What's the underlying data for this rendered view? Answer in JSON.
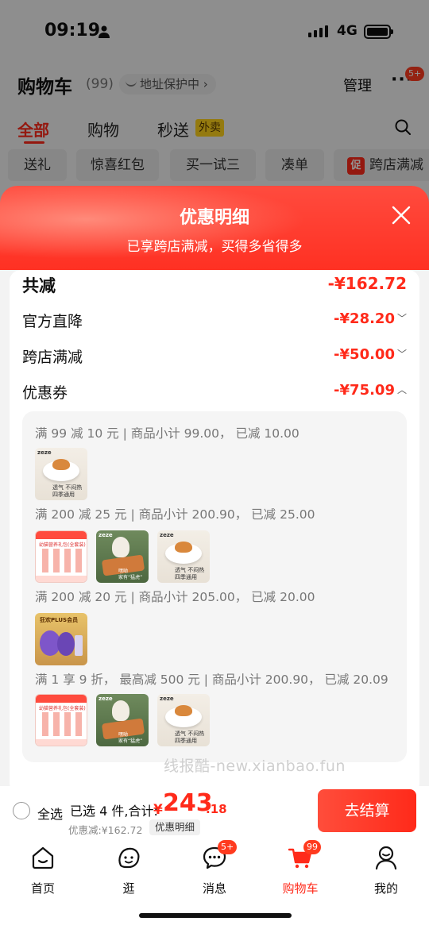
{
  "status": {
    "time": "09:19",
    "network": "4G"
  },
  "header": {
    "title": "购物车",
    "count": "(99)",
    "address_protect": "地址保护中 ›",
    "manage": "管理",
    "more": "···",
    "more_badge": "5+"
  },
  "tabs": [
    {
      "label": "全部"
    },
    {
      "label": "购物"
    },
    {
      "label": "秒送"
    }
  ],
  "takeaway_tag": "外卖",
  "chips": [
    {
      "label": "送礼"
    },
    {
      "label": "惊喜红包"
    },
    {
      "label": "买一试三"
    },
    {
      "label": "凑单"
    },
    {
      "label": "跨店满减"
    }
  ],
  "promo_icon_text": "促",
  "sheet": {
    "title": "优惠明细",
    "subtitle": "已享跨店满减，买得多省得多",
    "rows": [
      {
        "label": "共减",
        "amount": "-¥162.72"
      },
      {
        "label": "官方直降",
        "amount": "-¥28.20",
        "chevron": "﹀"
      },
      {
        "label": "跨店满减",
        "amount": "-¥50.00",
        "chevron": "﹀"
      },
      {
        "label": "优惠券",
        "amount": "-¥75.09",
        "chevron": "︿"
      }
    ],
    "coupons": [
      {
        "text": "满 99 减 10 元 | 商品小计 99.00， 已减 10.00"
      },
      {
        "text": "满 200 减 25 元 | 商品小计 200.90， 已减 25.00"
      },
      {
        "text": "满 200 减 20 元 | 商品小计 205.00， 已减 20.00"
      },
      {
        "text": "满 1 享 9 折， 最高减 500 元 | 商品小计 200.90， 已减 20.09"
      }
    ],
    "thumb_texts": {
      "pillow_brand": "zeze",
      "pillow_caption_1": "透气 不闷热",
      "pillow_caption_2": "四季通用",
      "box_title": "幼猫营养礼包(全套装)",
      "dog_brand": "zeze",
      "dog_caption_1": "嘿呦",
      "dog_caption_2": "家有“猛虎”",
      "purple_title": "狂欢PLUS会员"
    }
  },
  "watermark": "线报酷-new.xianbao.fun",
  "checkout": {
    "select_all": "全选",
    "selected_info": "已选 4 件,合计:",
    "total_yen": "¥",
    "total_int": "243",
    "total_dec": ".18",
    "saved": "优惠减:¥162.72",
    "detail_button": "优惠明细",
    "checkout_button": "去结算"
  },
  "tabbar": [
    {
      "label": "首页",
      "icon": "home-icon"
    },
    {
      "label": "逛",
      "icon": "browse-icon"
    },
    {
      "label": "消息",
      "icon": "message-icon",
      "badge": "5+"
    },
    {
      "label": "购物车",
      "icon": "cart-icon",
      "badge": "99",
      "active": true
    },
    {
      "label": "我的",
      "icon": "profile-icon"
    }
  ],
  "colors": {
    "accent": "#ff2a1a",
    "badge": "#ff3b1f",
    "takeaway": "#ffd21a"
  }
}
